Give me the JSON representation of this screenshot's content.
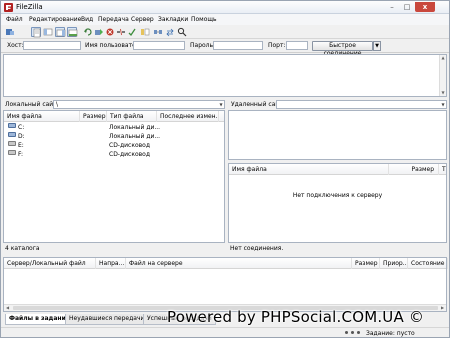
{
  "window": {
    "title": "FileZilla",
    "controls": [
      "–",
      "□",
      "x"
    ]
  },
  "menu": [
    "Файл",
    "Редактирование",
    "Вид",
    "Передача",
    "Сервер",
    "Закладки",
    "Помощь"
  ],
  "quickconnect": {
    "host_label": "Хост:",
    "user_label": "Имя пользователя",
    "pass_label": "Пароль:",
    "port_label": "Порт:",
    "host_value": "",
    "user_value": "",
    "pass_value": "",
    "port_value": "",
    "connect_button": "Быстрое соединение",
    "dropdown": "▼"
  },
  "local": {
    "site_label": "Локальный сайт:",
    "site_value": "\\",
    "tree": [
      {
        "icon": "computer-icon",
        "label": ""
      },
      {
        "icon": "drive-icon",
        "label": "C:"
      },
      {
        "icon": "drive-icon",
        "label": "D:"
      }
    ],
    "columns": [
      "Имя файла",
      "Размер",
      "Тип файла",
      "Последнее измен..."
    ],
    "rows": [
      {
        "name": "C:",
        "type": "Локальный ди..."
      },
      {
        "name": "D:",
        "type": "Локальный ди..."
      },
      {
        "name": "E:",
        "type": "CD-дисковод"
      },
      {
        "name": "F:",
        "type": "CD-дисковод"
      }
    ],
    "status": "4 каталога"
  },
  "remote": {
    "site_label": "Удаленный сайт:",
    "site_value": "",
    "columns": [
      "Имя файла",
      "Размер",
      "Т"
    ],
    "message": "Нет подключения к серверу",
    "status": "Нет соединения."
  },
  "queue": {
    "columns": [
      "Сервер/Локальный файл",
      "Напра...",
      "Файл на сервере",
      "Размер",
      "Приор...",
      "Состояние"
    ],
    "tabs": [
      "Файлы в задании",
      "Неудавшиеся передачи",
      "Успешные передачи"
    ],
    "status": "Задание: пусто"
  },
  "watermark": "Powered by PHPSocial.COM.UA ©"
}
